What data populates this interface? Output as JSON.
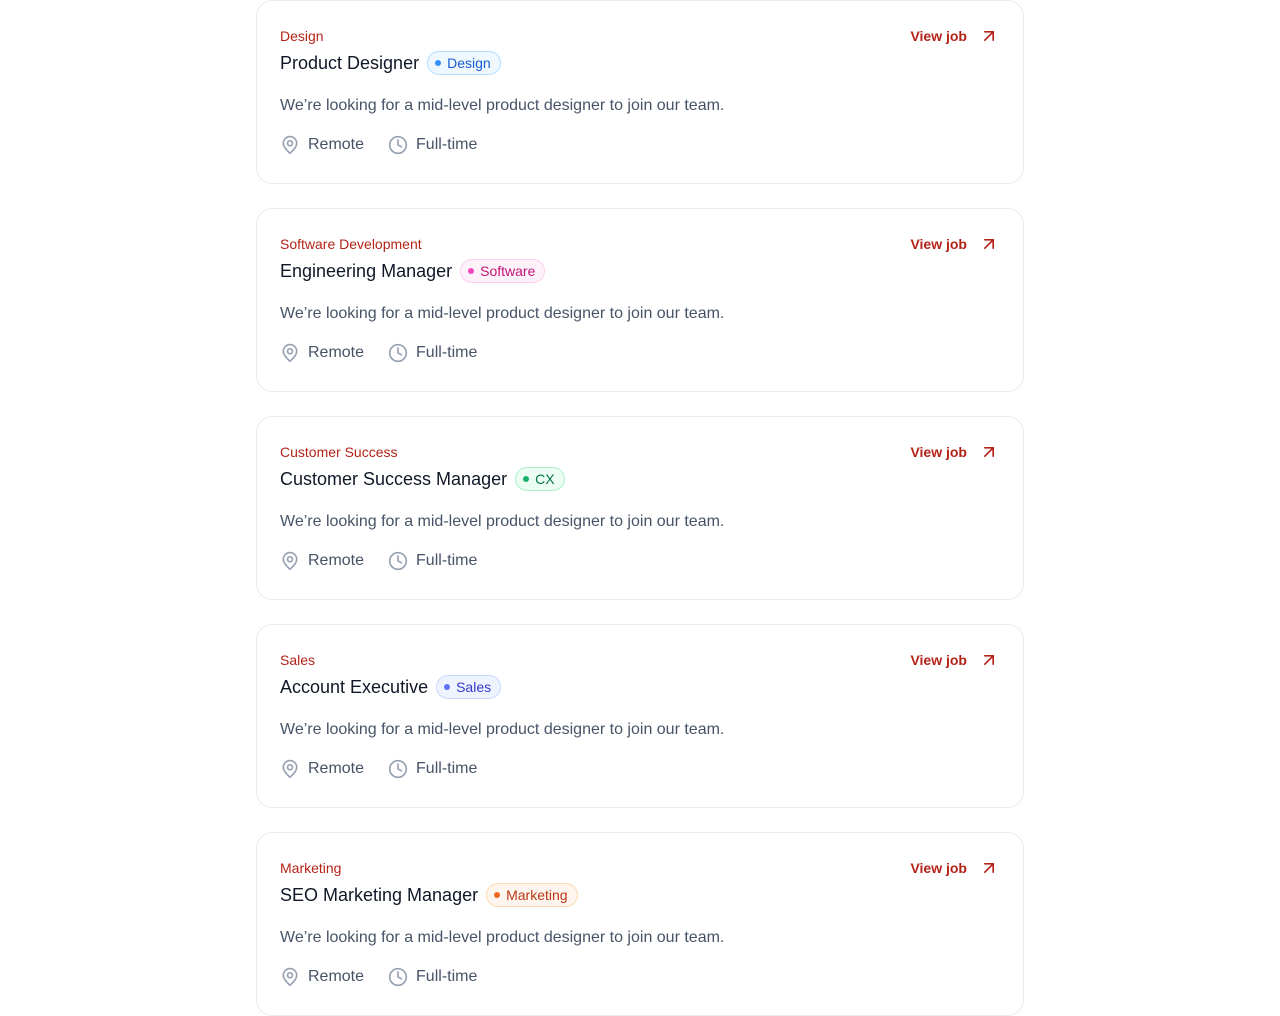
{
  "jobs": [
    {
      "department": "Design",
      "title": "Product Designer",
      "badge": "Design",
      "badge_colors": {
        "bg": "#eff8ff",
        "border": "#b2ddff",
        "text": "#175cd3",
        "dot": "#2e90fa"
      },
      "description": "We’re looking for a mid-level product designer to join our team.",
      "location": "Remote",
      "type": "Full-time",
      "view_label": "View job"
    },
    {
      "department": "Software Development",
      "title": "Engineering Manager",
      "badge": "Software",
      "badge_colors": {
        "bg": "#fdf2fa",
        "border": "#fcceee",
        "text": "#c11574",
        "dot": "#ee46bc"
      },
      "description": "We’re looking for a mid-level product designer to join our team.",
      "location": "Remote",
      "type": "Full-time",
      "view_label": "View job"
    },
    {
      "department": "Customer Success",
      "title": "Customer Success Manager",
      "badge": "CX",
      "badge_colors": {
        "bg": "#ecfdf3",
        "border": "#abefc6",
        "text": "#067647",
        "dot": "#17b26a"
      },
      "description": "We’re looking for a mid-level product designer to join our team.",
      "location": "Remote",
      "type": "Full-time",
      "view_label": "View job"
    },
    {
      "department": "Sales",
      "title": "Account Executive",
      "badge": "Sales",
      "badge_colors": {
        "bg": "#eef4ff",
        "border": "#c7d7fe",
        "text": "#3538cd",
        "dot": "#6172f3"
      },
      "description": "We’re looking for a mid-level product designer to join our team.",
      "location": "Remote",
      "type": "Full-time",
      "view_label": "View job"
    },
    {
      "department": "Marketing",
      "title": "SEO Marketing Manager",
      "badge": "Marketing",
      "badge_colors": {
        "bg": "#fef6ee",
        "border": "#f9dbaf",
        "text": "#b93815",
        "dot": "#ef6820"
      },
      "description": "We’re looking for a mid-level product designer to join our team.",
      "location": "Remote",
      "type": "Full-time",
      "view_label": "View job"
    }
  ],
  "icons": {
    "location": "marker-pin-icon",
    "type": "clock-icon",
    "view": "arrow-up-right-icon"
  }
}
